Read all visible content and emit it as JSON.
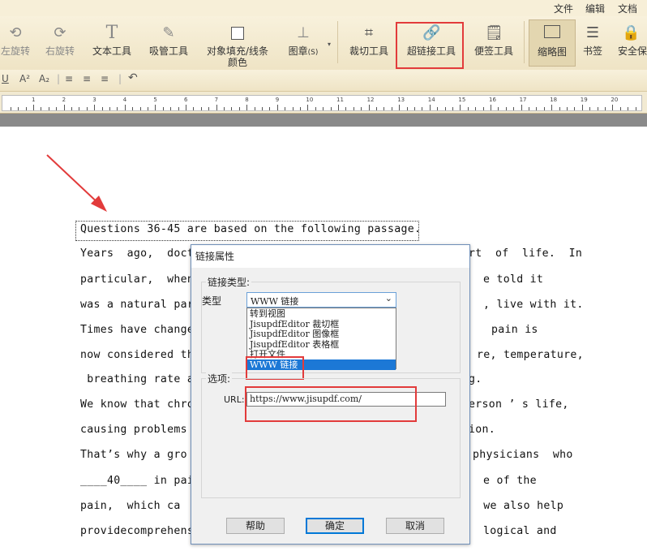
{
  "menubar": {
    "file": "文件",
    "edit": "编辑",
    "doc": "文档"
  },
  "ribbon": {
    "rotate_left": "左旋转",
    "rotate_right": "右旋转",
    "text_tool": "文本工具",
    "eyedropper": "吸管工具",
    "fill_line_1": "对象填充/线条",
    "fill_line_2": "颜色",
    "stamp": "图章",
    "stamp_shortcut": "(S)",
    "crop": "裁切工具",
    "hyperlink": "超链接工具",
    "sticky": "便签工具",
    "thumbnails": "缩略图",
    "bookmarks": "书签",
    "security": "安全保"
  },
  "format": {
    "underline": "U",
    "superscript": "A²",
    "subscript": "A₂"
  },
  "ruler": {
    "numbers": [
      "1",
      "2",
      "3",
      "4",
      "5",
      "6",
      "7",
      "8",
      "9",
      "10",
      "11",
      "12",
      "13",
      "14",
      "15",
      "16",
      "17",
      "18",
      "19",
      "20"
    ]
  },
  "document": {
    "lines_left": [
      "Questions 36-45 are based on the following passage.",
      "Years  ago,  docto",
      "particular,  when",
      "was a natural par",
      "Times have change",
      "now considered th",
      " breathing rate a",
      "We know that chro",
      "causing problems",
      "That’s why a gro",
      "____40____ in pai",
      "pain,  which ca",
      "providecomprehens"
    ],
    "lines_right": [
      "",
      "rt  of  life.  In",
      "e told it",
      ", live with it.",
      "pain is",
      "re, temperature,",
      "g.",
      "erson ’ s life,",
      "ion.",
      "physicians  who",
      "e of the",
      " we also help",
      "logical and"
    ]
  },
  "dialog": {
    "title": "链接属性",
    "link_type_group": "链接类型:",
    "type_label": "类型",
    "selected_type": "WWW 链接",
    "options": [
      "转到视图",
      "JisupdfEditor 裁切框",
      "JisupdfEditor 图像框",
      "JisupdfEditor 表格框",
      "打开文件",
      "WWW 链接"
    ],
    "options_group": "选项:",
    "url_label": "URL:",
    "url_value": "https://www.jisupdf.com/",
    "help": "帮助",
    "ok": "确定",
    "cancel": "取消"
  },
  "colors": {
    "highlight": "#e23b3b",
    "selection": "#1c78d6",
    "ribbon_bg": "#efe4c5"
  }
}
